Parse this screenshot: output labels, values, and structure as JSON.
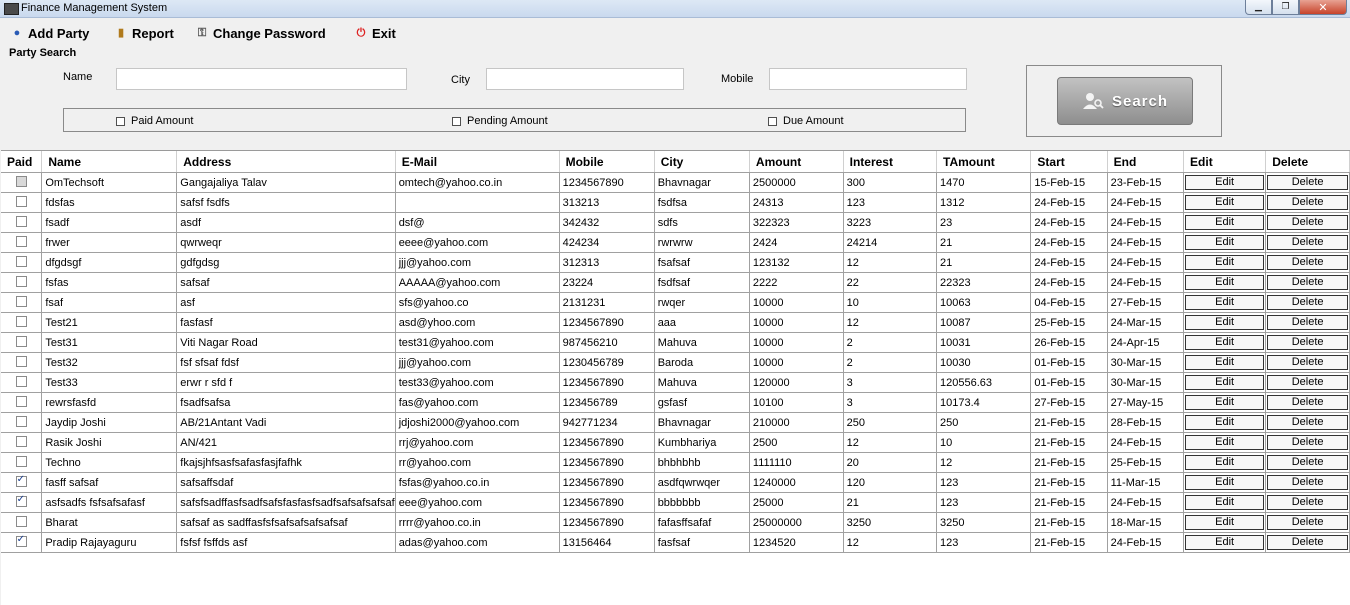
{
  "window": {
    "title": "Finance Management System"
  },
  "menu": {
    "add_party": "Add Party",
    "report": "Report",
    "change_password": "Change Password",
    "exit": "Exit"
  },
  "search": {
    "group_title": "Party Search",
    "name_label": "Name",
    "name_value": "",
    "city_label": "City",
    "city_value": "",
    "mobile_label": "Mobile",
    "mobile_value": "",
    "paid_amount": "Paid Amount",
    "pending_amount": "Pending Amount",
    "due_amount": "Due Amount",
    "button_label": "Search"
  },
  "table": {
    "columns": [
      "Paid",
      "Name",
      "Address",
      "E-Mail",
      "Mobile",
      "City",
      "Amount",
      "Interest",
      "TAmount",
      "Start",
      "End",
      "Edit",
      "Delete"
    ],
    "rows": [
      {
        "paid": false,
        "name": "OmTechsoft",
        "address": "Gangajaliya Talav",
        "email": "omtech@yahoo.co.in",
        "mobile": "1234567890",
        "city": "Bhavnagar",
        "amount": "2500000",
        "interest": "300",
        "tamount": "1470",
        "start": "15-Feb-15",
        "end": "23-Feb-15",
        "edit": "Edit",
        "delete": "Delete"
      },
      {
        "paid": false,
        "name": "fdsfas",
        "address": "safsf fsdfs",
        "email": "",
        "mobile": "313213",
        "city": "fsdfsa",
        "amount": "24313",
        "interest": "123",
        "tamount": "1312",
        "start": "24-Feb-15",
        "end": "24-Feb-15",
        "edit": "Edit",
        "delete": "Delete"
      },
      {
        "paid": false,
        "name": "fsadf",
        "address": "asdf",
        "email": "dsf@",
        "mobile": "342432",
        "city": "sdfs",
        "amount": "322323",
        "interest": "3223",
        "tamount": "23",
        "start": "24-Feb-15",
        "end": "24-Feb-15",
        "edit": "Edit",
        "delete": "Delete"
      },
      {
        "paid": false,
        "name": "frwer",
        "address": "qwrweqr",
        "email": "eeee@yahoo.com",
        "mobile": "424234",
        "city": "rwrwrw",
        "amount": "2424",
        "interest": "24214",
        "tamount": "21",
        "start": "24-Feb-15",
        "end": "24-Feb-15",
        "edit": "Edit",
        "delete": "Delete"
      },
      {
        "paid": false,
        "name": "dfgdsgf",
        "address": "gdfgdsg",
        "email": "jjj@yahoo.com",
        "mobile": "312313",
        "city": "fsafsaf",
        "amount": "123132",
        "interest": "12",
        "tamount": "21",
        "start": "24-Feb-15",
        "end": "24-Feb-15",
        "edit": "Edit",
        "delete": "Delete"
      },
      {
        "paid": false,
        "name": "fsfas",
        "address": "safsaf",
        "email": "AAAAA@yahoo.com",
        "mobile": "23224",
        "city": "fsdfsaf",
        "amount": "2222",
        "interest": "22",
        "tamount": "22323",
        "start": "24-Feb-15",
        "end": "24-Feb-15",
        "edit": "Edit",
        "delete": "Delete"
      },
      {
        "paid": false,
        "name": "fsaf",
        "address": "asf",
        "email": "sfs@yahoo.co",
        "mobile": "2131231",
        "city": "rwqer",
        "amount": "10000",
        "interest": "10",
        "tamount": "10063",
        "start": "04-Feb-15",
        "end": "27-Feb-15",
        "edit": "Edit",
        "delete": "Delete"
      },
      {
        "paid": false,
        "name": "Test21",
        "address": "fasfasf",
        "email": "asd@yhoo.com",
        "mobile": "1234567890",
        "city": "aaa",
        "amount": "10000",
        "interest": "12",
        "tamount": "10087",
        "start": "25-Feb-15",
        "end": "24-Mar-15",
        "edit": "Edit",
        "delete": "Delete"
      },
      {
        "paid": false,
        "name": "Test31",
        "address": "Viti Nagar Road",
        "email": "test31@yahoo.com",
        "mobile": "987456210",
        "city": "Mahuva",
        "amount": "10000",
        "interest": "2",
        "tamount": "10031",
        "start": "26-Feb-15",
        "end": "24-Apr-15",
        "edit": "Edit",
        "delete": "Delete"
      },
      {
        "paid": false,
        "name": "Test32",
        "address": "fsf sfsaf fdsf",
        "email": "jjj@yahoo.com",
        "mobile": "1230456789",
        "city": "Baroda",
        "amount": "10000",
        "interest": "2",
        "tamount": "10030",
        "start": "01-Feb-15",
        "end": "30-Mar-15",
        "edit": "Edit",
        "delete": "Delete"
      },
      {
        "paid": false,
        "name": "Test33",
        "address": "erwr r sfd f",
        "email": "test33@yahoo.com",
        "mobile": "1234567890",
        "city": "Mahuva",
        "amount": "120000",
        "interest": "3",
        "tamount": "120556.63",
        "start": "01-Feb-15",
        "end": "30-Mar-15",
        "edit": "Edit",
        "delete": "Delete"
      },
      {
        "paid": false,
        "name": "rewrsfasfd",
        "address": "fsadfsafsa",
        "email": "fas@yahoo.com",
        "mobile": "123456789",
        "city": "gsfasf",
        "amount": "10100",
        "interest": "3",
        "tamount": "10173.4",
        "start": "27-Feb-15",
        "end": "27-May-15",
        "edit": "Edit",
        "delete": "Delete"
      },
      {
        "paid": false,
        "name": "Jaydip Joshi",
        "address": "AB/21Antant Vadi",
        "email": "jdjoshi2000@yahoo.com",
        "mobile": "942771234",
        "city": "Bhavnagar",
        "amount": "210000",
        "interest": "250",
        "tamount": "250",
        "start": "21-Feb-15",
        "end": "28-Feb-15",
        "edit": "Edit",
        "delete": "Delete"
      },
      {
        "paid": false,
        "name": "Rasik Joshi",
        "address": "AN/421",
        "email": "rrj@yahoo.com",
        "mobile": "1234567890",
        "city": "Kumbhariya",
        "amount": "2500",
        "interest": "12",
        "tamount": "10",
        "start": "21-Feb-15",
        "end": "24-Feb-15",
        "edit": "Edit",
        "delete": "Delete"
      },
      {
        "paid": false,
        "name": "Techno",
        "address": "fkajsjhfsasfsafasfasjfafhk",
        "email": "rr@yahoo.com",
        "mobile": "1234567890",
        "city": "bhbhbhb",
        "amount": "1111110",
        "interest": "20",
        "tamount": "12",
        "start": "21-Feb-15",
        "end": "25-Feb-15",
        "edit": "Edit",
        "delete": "Delete"
      },
      {
        "paid": true,
        "name": "fasff safsaf",
        "address": "safsaffsdaf",
        "email": "fsfas@yahoo.co.in",
        "mobile": "1234567890",
        "city": "asdfqwrwqer",
        "amount": "1240000",
        "interest": "120",
        "tamount": "123",
        "start": "21-Feb-15",
        "end": "11-Mar-15",
        "edit": "Edit",
        "delete": "Delete"
      },
      {
        "paid": true,
        "name": "asfsadfs fsfsafsafasf",
        "address": "safsfsadffasfsadfsafsfasfasfsadfsafsafsafsaf",
        "email": "eee@yahoo.com",
        "mobile": "1234567890",
        "city": "bbbbbbb",
        "amount": "25000",
        "interest": "21",
        "tamount": "123",
        "start": "21-Feb-15",
        "end": "24-Feb-15",
        "edit": "Edit",
        "delete": "Delete"
      },
      {
        "paid": false,
        "name": "Bharat",
        "address": "safsaf as sadffasfsfsafsafsafsafsaf",
        "email": "rrrr@yahoo.co.in",
        "mobile": "1234567890",
        "city": "fafasffsafaf",
        "amount": "25000000",
        "interest": "3250",
        "tamount": "3250",
        "start": "21-Feb-15",
        "end": "18-Mar-15",
        "edit": "Edit",
        "delete": "Delete"
      },
      {
        "paid": true,
        "name": "Pradip Rajayaguru",
        "address": "fsfsf fsffds asf",
        "email": "adas@yahoo.com",
        "mobile": "13156464",
        "city": "fasfsaf",
        "amount": "1234520",
        "interest": "12",
        "tamount": "123",
        "start": "21-Feb-15",
        "end": "24-Feb-15",
        "edit": "Edit",
        "delete": "Delete"
      }
    ]
  }
}
